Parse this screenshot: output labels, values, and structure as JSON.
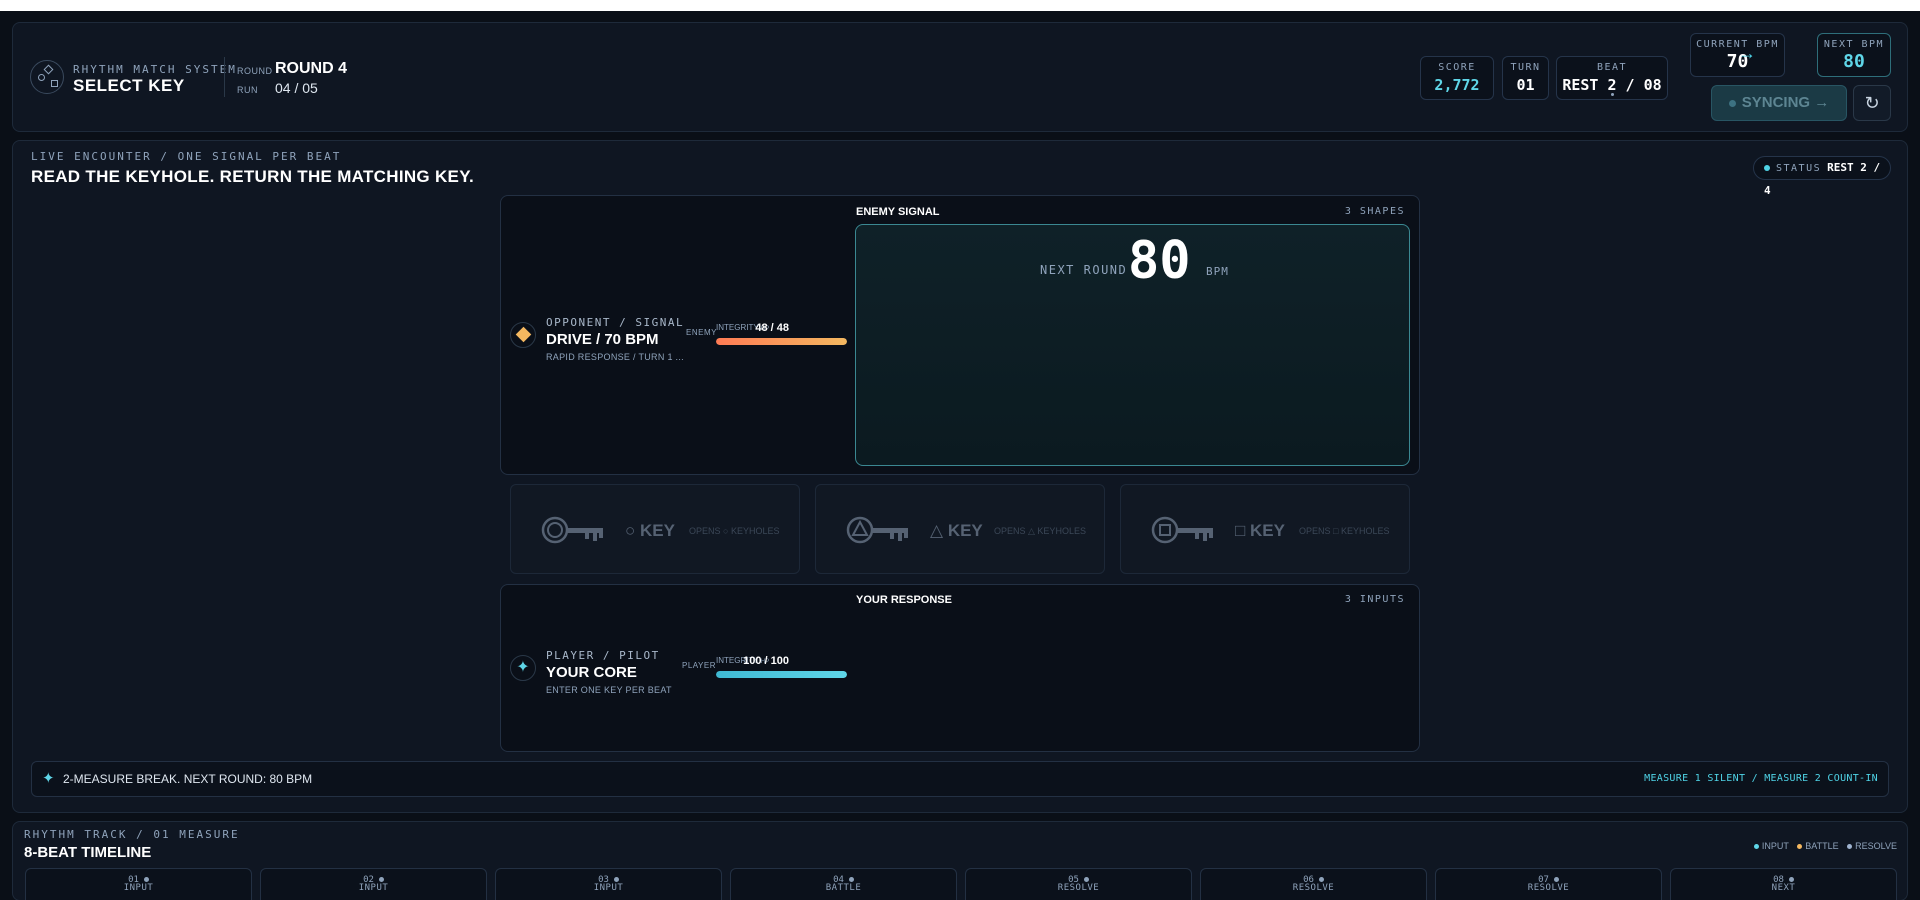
{
  "header": {
    "system_label": "RHYTHM MATCH SYSTEM",
    "title": "SELECT KEY",
    "round_label": "ROUND",
    "round_value": "ROUND 4",
    "run_label": "RUN",
    "run_value": "04 / 05",
    "stats": {
      "score_label": "SCORE",
      "score_value": "2,772",
      "turn_label": "TURN",
      "turn_value": "01",
      "beat_label": "BEAT",
      "beat_value": "REST 2 / 08"
    },
    "bpm": {
      "current_label": "CURRENT BPM",
      "current_value": "70",
      "arrow": "→",
      "next_label": "NEXT BPM",
      "next_value": "80"
    },
    "sync_button": "SYNCING →",
    "refresh_button": "↻"
  },
  "encounter": {
    "label": "LIVE ENCOUNTER / ONE SIGNAL PER BEAT",
    "title": "READ THE KEYHOLE. RETURN THE MATCHING KEY.",
    "status_label": "STATUS",
    "status_value": "REST 2 / 4"
  },
  "enemy": {
    "label": "OPPONENT / SIGNAL",
    "title": "DRIVE / 70 BPM",
    "subtitle": "RAPID RESPONSE / TURN 1 ...",
    "side_tag": "ENEMY",
    "hp_label": "INTEGRITY",
    "hp_unit": "HP",
    "hp_value": "48 / 48",
    "hp_fraction": 1.0,
    "section_title": "ENEMY SIGNAL",
    "section_count": "3 SHAPES",
    "next_round_label": "NEXT ROUND",
    "next_round_value": "80",
    "next_round_unit": "BPM"
  },
  "keys": [
    {
      "glyph": "○",
      "name": "KEY",
      "desc": "OPENS ○ KEYHOLES",
      "shape": "circle"
    },
    {
      "glyph": "△",
      "name": "KEY",
      "desc": "OPENS △ KEYHOLES",
      "shape": "triangle"
    },
    {
      "glyph": "□",
      "name": "KEY",
      "desc": "OPENS □ KEYHOLES",
      "shape": "square"
    }
  ],
  "player": {
    "label": "PLAYER / PILOT",
    "title": "YOUR CORE",
    "subtitle": "ENTER ONE KEY PER BEAT",
    "side_tag": "PLAYER",
    "hp_label": "INTEGRITY",
    "hp_unit": "HP",
    "hp_value": "100 / 100",
    "hp_fraction": 1.0,
    "section_title": "YOUR RESPONSE",
    "section_count": "3 INPUTS"
  },
  "break_bar": {
    "icon": "✦",
    "text": "2-MEASURE BREAK. NEXT ROUND: 80 BPM",
    "right_text": "MEASURE 1 SILENT / MEASURE 2 COUNT-IN"
  },
  "timeline": {
    "label": "RHYTHM TRACK / 01 MEASURE",
    "title": "8-BEAT TIMELINE",
    "legend": [
      {
        "label": "INPUT",
        "color": "#5fd6e8"
      },
      {
        "label": "BATTLE",
        "color": "#f4b860"
      },
      {
        "label": "RESOLVE",
        "color": "#9fb3d0"
      }
    ],
    "beats": [
      {
        "num": "01",
        "label": "INPUT"
      },
      {
        "num": "02",
        "label": "INPUT"
      },
      {
        "num": "03",
        "label": "INPUT"
      },
      {
        "num": "04",
        "label": "BATTLE"
      },
      {
        "num": "05",
        "label": "RESOLVE"
      },
      {
        "num": "06",
        "label": "RESOLVE"
      },
      {
        "num": "07",
        "label": "RESOLVE"
      },
      {
        "num": "08",
        "label": "NEXT"
      }
    ]
  },
  "colors": {
    "accent": "#4fd3e6",
    "enemy_accent": "#f4b860",
    "background": "#0a0f17"
  }
}
